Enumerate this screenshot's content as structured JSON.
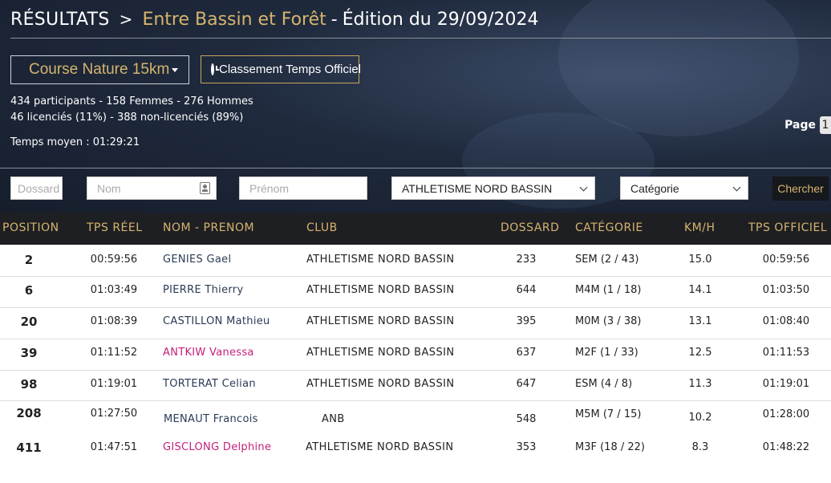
{
  "header": {
    "results": "RÉSULTATS",
    "chevron": ">",
    "event_name": "Entre Bassin et Forêt",
    "separator": "-",
    "edition": "Édition du 29/09/2024"
  },
  "race_select": {
    "value": "Course Nature 15km"
  },
  "classement_button": {
    "label": "Classement Temps Officiel"
  },
  "stats": {
    "participants": "434 participants - 158 Femmes - 276 Hommes",
    "licencies": "46 licenciés (11%) - 388 non-licenciés (89%)",
    "temps_moyen": "Temps moyen : 01:29:21"
  },
  "pager": {
    "label": "Page",
    "current": "1"
  },
  "filters": {
    "dossard_placeholder": "Dossard",
    "nom_placeholder": "Nom",
    "prenom_placeholder": "Prénom",
    "club_value": "ATHLETISME NORD BASSIN",
    "categorie_value": "Catégorie",
    "search_label": "Chercher"
  },
  "table": {
    "columns": [
      "POSITION",
      "TPS RÉEL",
      "NOM - PRENOM",
      "CLUB",
      "DOSSARD",
      "CATÉGORIE",
      "KM/H",
      "TPS OFFICIEL"
    ],
    "rows": [
      {
        "position": "2",
        "tps_reel": "00:59:56",
        "name": "GENIES Gael",
        "club": "ATHLETISME NORD BASSIN",
        "dossard": "233",
        "categorie": "SEM (2 / 43)",
        "kmh": "15.0",
        "tps_officiel": "00:59:56"
      },
      {
        "position": "6",
        "tps_reel": "01:03:49",
        "name": "PIERRE Thierry",
        "club": "ATHLETISME NORD BASSIN",
        "dossard": "644",
        "categorie": "M4M (1 / 18)",
        "kmh": "14.1",
        "tps_officiel": "01:03:50"
      },
      {
        "position": "20",
        "tps_reel": "01:08:39",
        "name": "CASTILLON Mathieu",
        "club": "ATHLETISME NORD BASSIN",
        "dossard": "395",
        "categorie": "M0M (3 / 38)",
        "kmh": "13.1",
        "tps_officiel": "01:08:40"
      },
      {
        "position": "39",
        "tps_reel": "01:11:52",
        "name": "ANTKIW Vanessa",
        "club": "ATHLETISME NORD BASSIN",
        "dossard": "637",
        "categorie": "M2F (1 / 33)",
        "kmh": "12.5",
        "tps_officiel": "01:11:53"
      },
      {
        "position": "98",
        "tps_reel": "01:19:01",
        "name": "TORTERAT Celian",
        "club": "ATHLETISME NORD BASSIN",
        "dossard": "647",
        "categorie": "ESM (4 / 8)",
        "kmh": "11.3",
        "tps_officiel": "01:19:01"
      },
      {
        "position": "208",
        "tps_reel": "01:27:50",
        "name": "MENAUT Francois",
        "club": "ANB",
        "dossard": "548",
        "categorie": "M5M (7 / 15)",
        "kmh": "10.2",
        "tps_officiel": "01:28:00"
      },
      {
        "position": "411",
        "tps_reel": "01:47:51",
        "name": "GISCLONG Delphine",
        "club": "ATHLETISME NORD BASSIN",
        "dossard": "353",
        "categorie": "M3F (18 / 22)",
        "kmh": "8.3",
        "tps_officiel": "01:48:22"
      }
    ]
  },
  "colors": {
    "accent": "#d6b46e",
    "female_name": "#c4207a",
    "male_name": "#2a3b55"
  }
}
